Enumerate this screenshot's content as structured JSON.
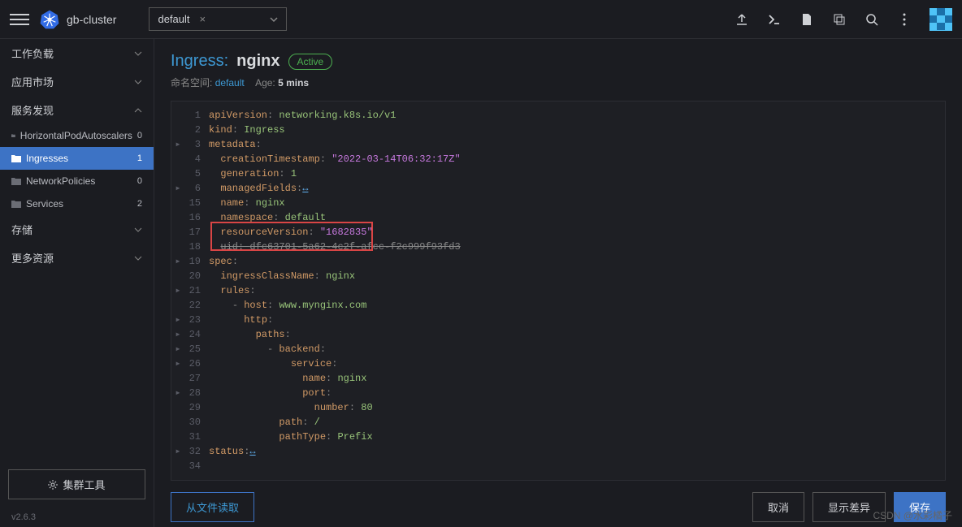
{
  "topbar": {
    "cluster": "gb-cluster",
    "namespace": "default"
  },
  "sidebar": {
    "groups": {
      "workload": "工作负载",
      "apps": "应用市场",
      "discovery": "服务发现",
      "storage": "存储",
      "more": "更多资源"
    },
    "discovery_items": [
      {
        "label": "HorizontalPodAutoscalers",
        "count": "0"
      },
      {
        "label": "Ingresses",
        "count": "1"
      },
      {
        "label": "NetworkPolicies",
        "count": "0"
      },
      {
        "label": "Services",
        "count": "2"
      }
    ],
    "cluster_tools": "集群工具",
    "version": "v2.6.3"
  },
  "header": {
    "type": "Ingress:",
    "name": "nginx",
    "status": "Active",
    "ns_label": "命名空间:",
    "ns_value": "default",
    "age_label": "Age:",
    "age_value": "5 mins"
  },
  "yaml": {
    "apiVersion": "networking.k8s.io/v1",
    "kind": "Ingress",
    "creationTimestamp": "\"2022-03-14T06:32:17Z\"",
    "generation": "1",
    "name": "nginx",
    "namespace": "default",
    "resourceVersion": "\"1682835\"",
    "uid": "dfc63701-5a62-4c2f-afcc-f2c999f93fd3",
    "ingressClassName": "nginx",
    "host": "www.mynginx.com",
    "service_name": "nginx",
    "port_number": "80",
    "path": "/",
    "pathType": "Prefix"
  },
  "buttons": {
    "read_file": "从文件读取",
    "cancel": "取消",
    "diff": "显示差异",
    "save": "保存"
  },
  "watermark": "CSDN @水彩橘子"
}
